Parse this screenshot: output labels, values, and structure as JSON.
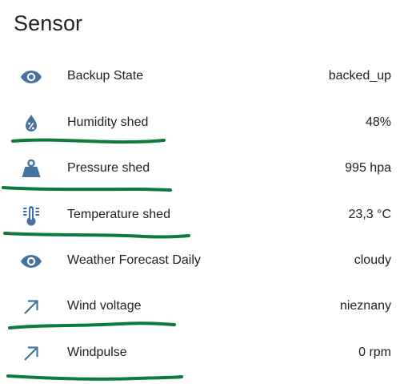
{
  "card": {
    "title": "Sensor"
  },
  "entities": [
    {
      "icon": "eye-icon",
      "label": "Backup State",
      "value": "backed_up"
    },
    {
      "icon": "water-percent-icon",
      "label": "Humidity shed",
      "value": "48%"
    },
    {
      "icon": "weight-icon",
      "label": "Pressure shed",
      "value": "995 hpa"
    },
    {
      "icon": "thermometer-icon",
      "label": "Temperature shed",
      "value": "23,3 °C"
    },
    {
      "icon": "eye-icon",
      "label": "Weather Forecast Daily",
      "value": "cloudy"
    },
    {
      "icon": "arrow-top-right-icon",
      "label": "Wind voltage",
      "value": "nieznany"
    },
    {
      "icon": "arrow-top-right-icon",
      "label": "Windpulse",
      "value": "0 rpm"
    }
  ],
  "colors": {
    "icon": "#44739e",
    "text": "#212121",
    "annotation": "#0d7a3e"
  }
}
